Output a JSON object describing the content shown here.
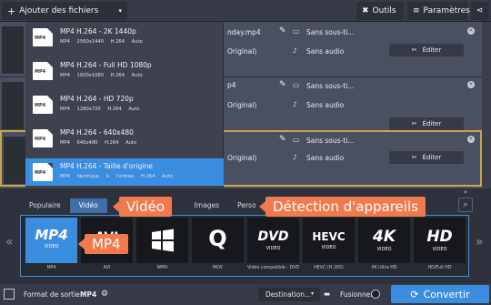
{
  "toolbar": {
    "add_files": "Ajouter des fichiers",
    "tools": "Outils",
    "settings": "Paramètres"
  },
  "files": [
    {
      "name": "nday.mp4",
      "audio_track": "Original)",
      "subtitles": "Sans sous-ti...",
      "audio": "Sans audio",
      "edit": "Éditer"
    },
    {
      "name": "p4",
      "audio_track": "Original)",
      "subtitles": "Sans sous-ti...",
      "audio": "Sans audio",
      "edit": "Éditer"
    },
    {
      "name": "",
      "audio_track": "Original)",
      "subtitles": "Sans sous-ti...",
      "audio": "Sans audio",
      "edit": "Éditer"
    }
  ],
  "dropdown": [
    {
      "title": "MP4 H.264 - 2K 1440p",
      "spec": "MP4 2560x1440 H.264 Auto"
    },
    {
      "title": "MP4 H.264 - Full HD 1080p",
      "spec": "MP4 1920x1080 H.264 Auto"
    },
    {
      "title": "MP4 H.264 - HD 720p",
      "spec": "MP4 1280x720 H.264 Auto"
    },
    {
      "title": "MP4 H.264 - 640x480",
      "spec": "MP4 640x480 H.264 Auto"
    },
    {
      "title": "MP4 H.264 - Taille d'origine",
      "spec": "MP4 Identique à l'entrée H.264 Auto"
    }
  ],
  "tabs": [
    "Populaire",
    "Vidéo",
    "Images",
    "Perso"
  ],
  "callouts": {
    "video": "Vidéo",
    "detection": "Détection d'appareils",
    "mp4": "MP4"
  },
  "formats": [
    {
      "big": "MP4",
      "label": "MP4"
    },
    {
      "big": "AVI",
      "label": "AVI"
    },
    {
      "big": "",
      "label": "WMV"
    },
    {
      "big": "Q",
      "label": "MOV"
    },
    {
      "big": "DVD",
      "label": "Vidéo compatible - DVD"
    },
    {
      "big": "HEVC",
      "label": "HEVC (H.265)"
    },
    {
      "big": "4K",
      "label": "4K Ultra HD"
    },
    {
      "big": "HD",
      "label": "HD/Full HD"
    }
  ],
  "bottom": {
    "output_label": "Format de sortie :",
    "output_value": "MP4",
    "destination": "Destination...",
    "merge": "Fusionner",
    "convert": "Convertir"
  },
  "colors": {
    "accent": "#3b8de0",
    "callout": "#f07a4e",
    "selected_border": "#c9a64b"
  }
}
